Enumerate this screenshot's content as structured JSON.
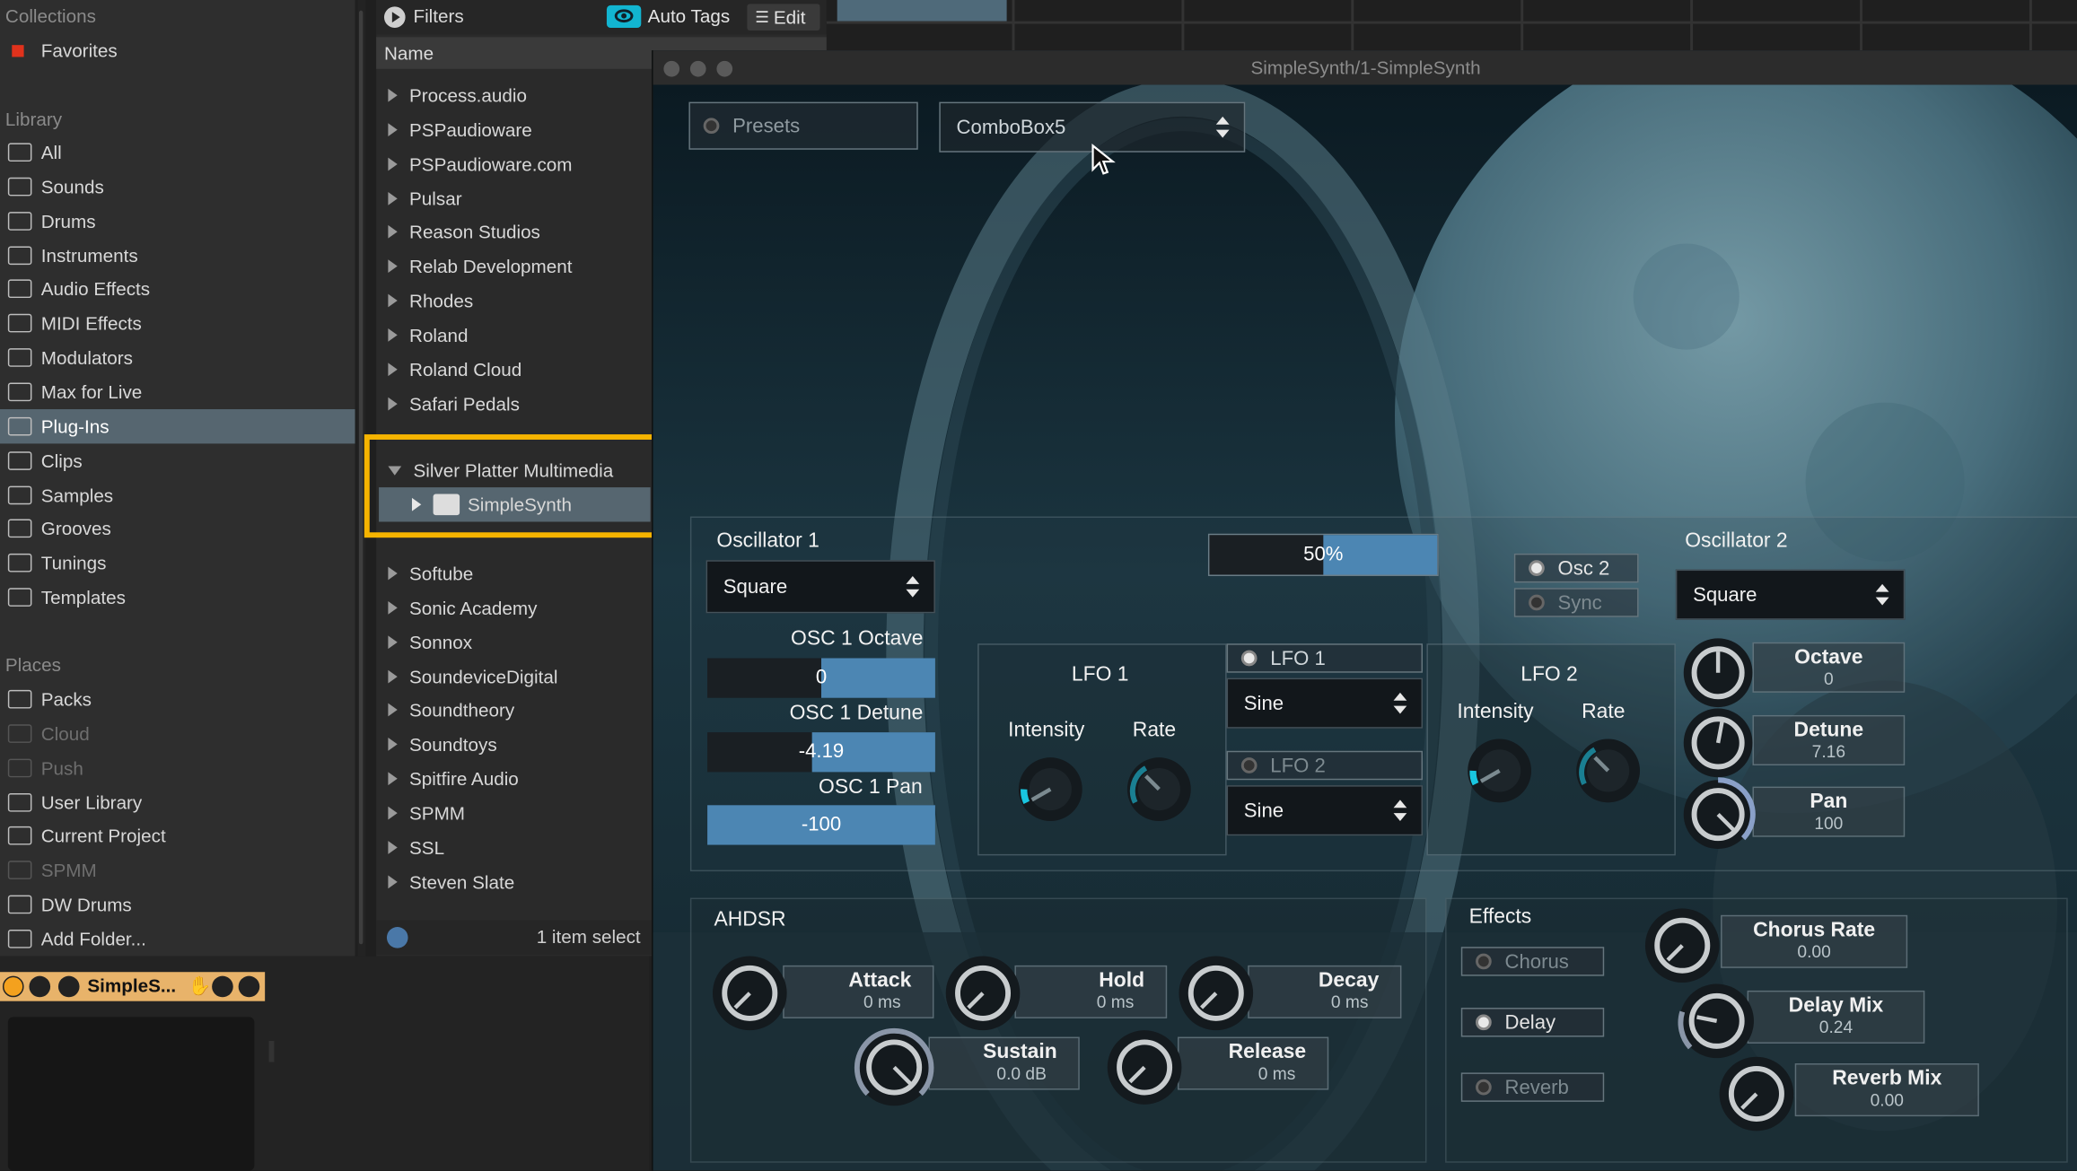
{
  "sidebar": {
    "collections_header": "Collections",
    "favorites": "Favorites",
    "favorites_color": "#e0321c",
    "library_header": "Library",
    "library_items": [
      "All",
      "Sounds",
      "Drums",
      "Instruments",
      "Audio Effects",
      "MIDI Effects",
      "Modulators",
      "Max for Live",
      "Plug-Ins",
      "Clips",
      "Samples",
      "Grooves",
      "Tunings",
      "Templates"
    ],
    "selected_item": "Plug-Ins",
    "places_header": "Places",
    "places_items": [
      "Packs",
      "Cloud",
      "Push",
      "User Library",
      "Current Project",
      "SPMM",
      "DW Drums",
      "Add Folder..."
    ]
  },
  "browser": {
    "filters_label": "Filters",
    "auto_tags_label": "Auto Tags",
    "edit_label": "Edit",
    "name_column": "Name",
    "rows_top": [
      "Process.audio",
      "PSPaudioware",
      "PSPaudioware.com",
      "Pulsar",
      "Reason Studios",
      "Relab Development",
      "Rhodes",
      "Roland",
      "Roland Cloud",
      "Safari Pedals"
    ],
    "expanded_vendor": "Silver Platter Multimedia",
    "selected_plugin": "SimpleSynth",
    "rows_bottom": [
      "Softube",
      "Sonic Academy",
      "Sonnox",
      "SoundeviceDigital",
      "Soundtheory",
      "Soundtoys",
      "Spitfire Audio",
      "SPMM",
      "SSL",
      "Steven Slate"
    ],
    "status": "1 item select"
  },
  "device_chip": {
    "label": "SimpleS..."
  },
  "plugin": {
    "window_title": "SimpleSynth/1-SimpleSynth",
    "presets_label": "Presets",
    "combobox": "ComboBox5",
    "osc1": {
      "title": "Oscillator 1",
      "wave": "Square",
      "octave_label": "OSC 1 Octave",
      "octave_value": "0",
      "octave_fill": 0.5,
      "detune_label": "OSC 1 Detune",
      "detune_value": "-4.19",
      "detune_fill": 0.46,
      "pan_label": "OSC 1 Pan",
      "pan_value": "-100",
      "pan_fill": 1.0
    },
    "mix": {
      "value": "50%",
      "fill": 0.5
    },
    "lfo1": {
      "title": "LFO 1",
      "intensity_label": "Intensity",
      "rate_label": "Rate",
      "toggle_label": "LFO 1",
      "wave": "Sine"
    },
    "lfo2": {
      "title": "LFO 2",
      "intensity_label": "Intensity",
      "rate_label": "Rate",
      "toggle_label": "LFO 2",
      "wave": "Sine"
    },
    "osc2": {
      "title": "Oscillator 2",
      "toggle_label": "Osc 2",
      "sync_label": "Sync",
      "wave": "Square",
      "octave_label": "Octave",
      "octave_value": "0",
      "detune_label": "Detune",
      "detune_value": "7.16",
      "pan_label": "Pan",
      "pan_value": "100"
    },
    "ahdsr": {
      "title": "AHDSR",
      "attack_label": "Attack",
      "attack_value": "0 ms",
      "hold_label": "Hold",
      "hold_value": "0 ms",
      "decay_label": "Decay",
      "decay_value": "0 ms",
      "sustain_label": "Sustain",
      "sustain_value": "0.0 dB",
      "release_label": "Release",
      "release_value": "0 ms"
    },
    "effects": {
      "title": "Effects",
      "chorus_label": "Chorus",
      "delay_label": "Delay",
      "reverb_label": "Reverb",
      "chorus_rate_label": "Chorus Rate",
      "chorus_rate_value": "0.00",
      "delay_mix_label": "Delay Mix",
      "delay_mix_value": "0.24",
      "reverb_mix_label": "Reverb Mix",
      "reverb_mix_value": "0.00"
    },
    "accent_color": "#4c86b3",
    "highlight_color": "#f6b400"
  }
}
